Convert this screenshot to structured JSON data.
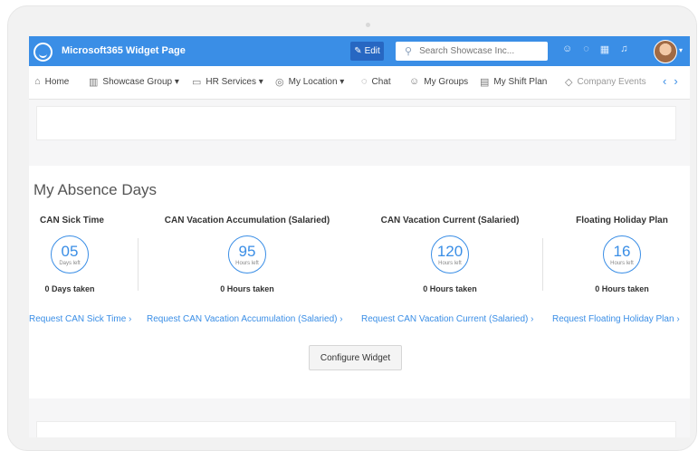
{
  "app": {
    "title": "Microsoft365 Widget Page"
  },
  "toolbar": {
    "edit_label": "Edit"
  },
  "search": {
    "placeholder": "Search Showcase Inc..."
  },
  "nav": {
    "items": [
      {
        "label": "Home",
        "icon": "home-icon"
      },
      {
        "label": "Showcase Group ▾",
        "icon": "building-icon"
      },
      {
        "label": "HR Services ▾",
        "icon": "folder-icon"
      },
      {
        "label": "My Location ▾",
        "icon": "location-icon"
      },
      {
        "label": "Chat",
        "icon": "chat-icon"
      },
      {
        "label": "My Groups",
        "icon": "groups-icon"
      },
      {
        "label": "My Shift Plan",
        "icon": "calendar-icon"
      },
      {
        "label": "Company Events",
        "icon": "tag-icon"
      }
    ]
  },
  "absence": {
    "title": "My Absence Days",
    "columns": [
      {
        "title": "CAN Sick Time",
        "value": "05",
        "unit": "Days left",
        "taken": "0 Days taken",
        "request": "Request CAN Sick Time"
      },
      {
        "title": "CAN Vacation Accumulation (Salaried)",
        "value": "95",
        "unit": "Hours left",
        "taken": "0 Hours taken",
        "request": "Request CAN Vacation Accumulation (Salaried)"
      },
      {
        "title": "CAN Vacation Current (Salaried)",
        "value": "120",
        "unit": "Hours left",
        "taken": "0 Hours taken",
        "request": "Request CAN Vacation Current (Salaried)"
      },
      {
        "title": "Floating Holiday Plan",
        "value": "16",
        "unit": "Hours left",
        "taken": "0 Hours taken",
        "request": "Request Floating Holiday Plan"
      }
    ],
    "configure_label": "Configure Widget"
  },
  "colors": {
    "accent": "#3a8ee6",
    "topbar": "#3a8ee6",
    "edit_button": "#2767c2"
  }
}
